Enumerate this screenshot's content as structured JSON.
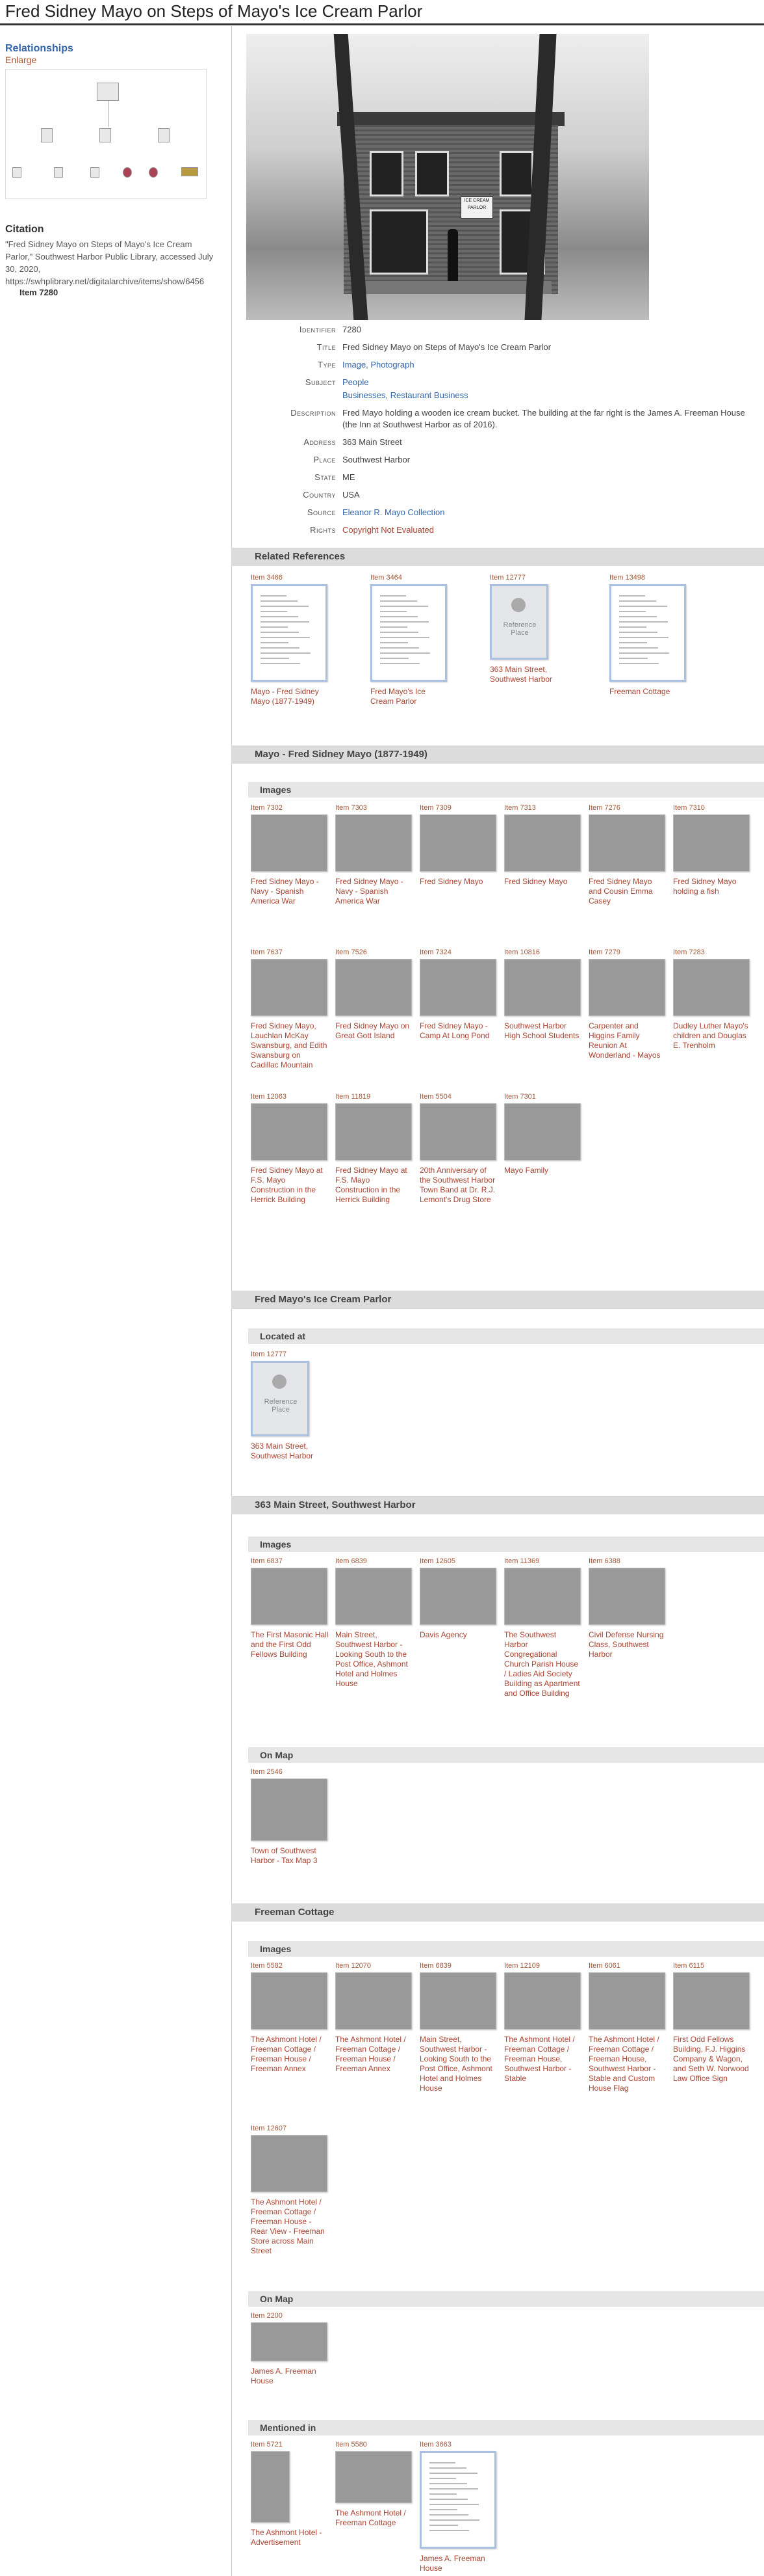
{
  "page": {
    "title": "Fred Sidney Mayo on Steps of Mayo's Ice Cream Parlor"
  },
  "sidebar": {
    "relationships_label": "Relationships",
    "enlarge_label": "Enlarge",
    "citation_heading": "Citation",
    "citation_text": "\"Fred Sidney Mayo on Steps of Mayo's Ice Cream Parlor,\" Southwest Harbor Public Library, accessed July 30, 2020, https://swhplibrary.net/digitalarchive/items/show/6456",
    "citation_item": "Item 7280"
  },
  "photo": {
    "sign_text": "ICE CREAM PARLOR"
  },
  "metadata": [
    {
      "label": "Identifier",
      "value": "7280",
      "style": "plain"
    },
    {
      "label": "Title",
      "value": "Fred Sidney Mayo on Steps of Mayo's Ice Cream Parlor",
      "style": "plain"
    },
    {
      "label": "Type",
      "value": "Image, Photograph",
      "style": "link"
    },
    {
      "label": "Subject",
      "value": "People",
      "style": "link"
    },
    {
      "label": "",
      "value": "Businesses, Restaurant Business",
      "style": "link"
    },
    {
      "label": "Description",
      "value": "Fred Mayo holding a wooden ice cream bucket. The building at the far right is the James A. Freeman House (the Inn at Southwest Harbor as of 2016).",
      "style": "plain"
    },
    {
      "label": "Address",
      "value": "363 Main Street",
      "style": "plain"
    },
    {
      "label": "Place",
      "value": "Southwest Harbor",
      "style": "plain"
    },
    {
      "label": "State",
      "value": "ME",
      "style": "plain"
    },
    {
      "label": "Country",
      "value": "USA",
      "style": "plain"
    },
    {
      "label": "Source",
      "value": "Eleanor R. Mayo Collection",
      "style": "link"
    },
    {
      "label": "Rights",
      "value": "Copyright Not Evaluated",
      "style": "warn"
    }
  ],
  "sections": {
    "related_references": "Related References",
    "mayo_fred": "Mayo - Fred Sidney Mayo (1877-1949)",
    "mayo_images": "Images",
    "parlor": "Fred Mayo's Ice Cream Parlor",
    "parlor_located": "Located at",
    "main_street": "363 Main Street, Southwest Harbor",
    "main_images": "Images",
    "main_map": "On Map",
    "freeman": "Freeman Cottage",
    "freeman_images": "Images",
    "freeman_map": "On Map",
    "freeman_mentioned": "Mentioned in"
  },
  "related_refs": [
    {
      "item": "Item 3466",
      "caption": "Mayo - Fred Sidney Mayo (1877-1949)"
    },
    {
      "item": "Item 3464",
      "caption": "Fred Mayo's Ice Cream Parlor"
    },
    {
      "item": "Item 12777",
      "caption": "363 Main Street, Southwest Harbor"
    },
    {
      "item": "Item 13498",
      "caption": "Freeman Cottage"
    }
  ],
  "ref_place_label": "Reference Place",
  "mayo_images": [
    {
      "item": "Item 7302",
      "caption": "Fred Sidney Mayo - Navy - Spanish America War"
    },
    {
      "item": "Item 7303",
      "caption": "Fred Sidney Mayo - Navy - Spanish America War"
    },
    {
      "item": "Item 7309",
      "caption": "Fred Sidney Mayo"
    },
    {
      "item": "Item 7313",
      "caption": "Fred Sidney Mayo"
    },
    {
      "item": "Item 7276",
      "caption": "Fred Sidney Mayo and Cousin Emma Casey"
    },
    {
      "item": "Item 7310",
      "caption": "Fred Sidney Mayo holding a fish"
    },
    {
      "item": "Item 7637",
      "caption": "Fred Sidney Mayo, Lauchlan McKay Swansburg, and Edith Swansburg on Cadillac Mountain"
    },
    {
      "item": "Item 7526",
      "caption": "Fred Sidney Mayo on Great Gott Island"
    },
    {
      "item": "Item 7324",
      "caption": "Fred Sidney Mayo - Camp At Long Pond"
    },
    {
      "item": "Item 10816",
      "caption": "Southwest Harbor High School Students"
    },
    {
      "item": "Item 7279",
      "caption": "Carpenter and Higgins Family Reunion At Wonderland - Mayos"
    },
    {
      "item": "Item 7283",
      "caption": "Dudley Luther Mayo's children and Douglas E. Trenholm"
    },
    {
      "item": "Item 12063",
      "caption": "Fred Sidney Mayo at F.S. Mayo Construction in the Herrick Building"
    },
    {
      "item": "Item 11819",
      "caption": "Fred Sidney Mayo at F.S. Mayo Construction in the Herrick Building"
    },
    {
      "item": "Item 5504",
      "caption": "20th Anniversary of the Southwest Harbor Town Band at Dr. R.J. Lemont's Drug Store"
    },
    {
      "item": "Item 7301",
      "caption": "Mayo Family"
    }
  ],
  "parlor_located": [
    {
      "item": "Item 12777",
      "caption": "363 Main Street, Southwest Harbor"
    }
  ],
  "main_images": [
    {
      "item": "Item 6837",
      "caption": "The First Masonic Hall and the First Odd Fellows Building"
    },
    {
      "item": "Item 6839",
      "caption": "Main Street, Southwest Harbor - Looking South to the Post Office, Ashmont Hotel and Holmes House"
    },
    {
      "item": "Item 12605",
      "caption": "Davis Agency"
    },
    {
      "item": "Item 11369",
      "caption": "The Southwest Harbor Congregational Church Parish House / Ladies Aid Society Building as Apartment and Office Building"
    },
    {
      "item": "Item 6388",
      "caption": "Civil Defense Nursing Class, Southwest Harbor"
    }
  ],
  "main_map": [
    {
      "item": "Item 2546",
      "caption": "Town of Southwest Harbor - Tax Map 3"
    }
  ],
  "freeman_images": [
    {
      "item": "Item 5582",
      "caption": "The Ashmont Hotel / Freeman Cottage / Freeman House / Freeman Annex"
    },
    {
      "item": "Item 12070",
      "caption": "The Ashmont Hotel / Freeman Cottage / Freeman House / Freeman Annex"
    },
    {
      "item": "Item 6839",
      "caption": "Main Street, Southwest Harbor - Looking South to the Post Office, Ashmont Hotel and Holmes House"
    },
    {
      "item": "Item 12109",
      "caption": "The Ashmont Hotel / Freeman Cottage / Freeman House, Southwest Harbor - Stable"
    },
    {
      "item": "Item 6061",
      "caption": "The Ashmont Hotel / Freeman Cottage / Freeman House, Southwest Harbor - Stable and Custom House Flag"
    },
    {
      "item": "Item 6115",
      "caption": "First Odd Fellows Building, F.J. Higgins Company & Wagon, and Seth W. Norwood Law Office Sign"
    },
    {
      "item": "Item 12607",
      "caption": "The Ashmont Hotel / Freeman Cottage / Freeman House - Rear View - Freeman Store across Main Street"
    }
  ],
  "freeman_map": [
    {
      "item": "Item 2200",
      "caption": "James A. Freeman House"
    }
  ],
  "freeman_mentioned": [
    {
      "item": "Item 5721",
      "caption": "The Ashmont Hotel - Advertisement"
    },
    {
      "item": "Item 5580",
      "caption": "The Ashmont Hotel / Freeman Cottage"
    },
    {
      "item": "Item 3663",
      "caption": "James A. Freeman House"
    }
  ]
}
